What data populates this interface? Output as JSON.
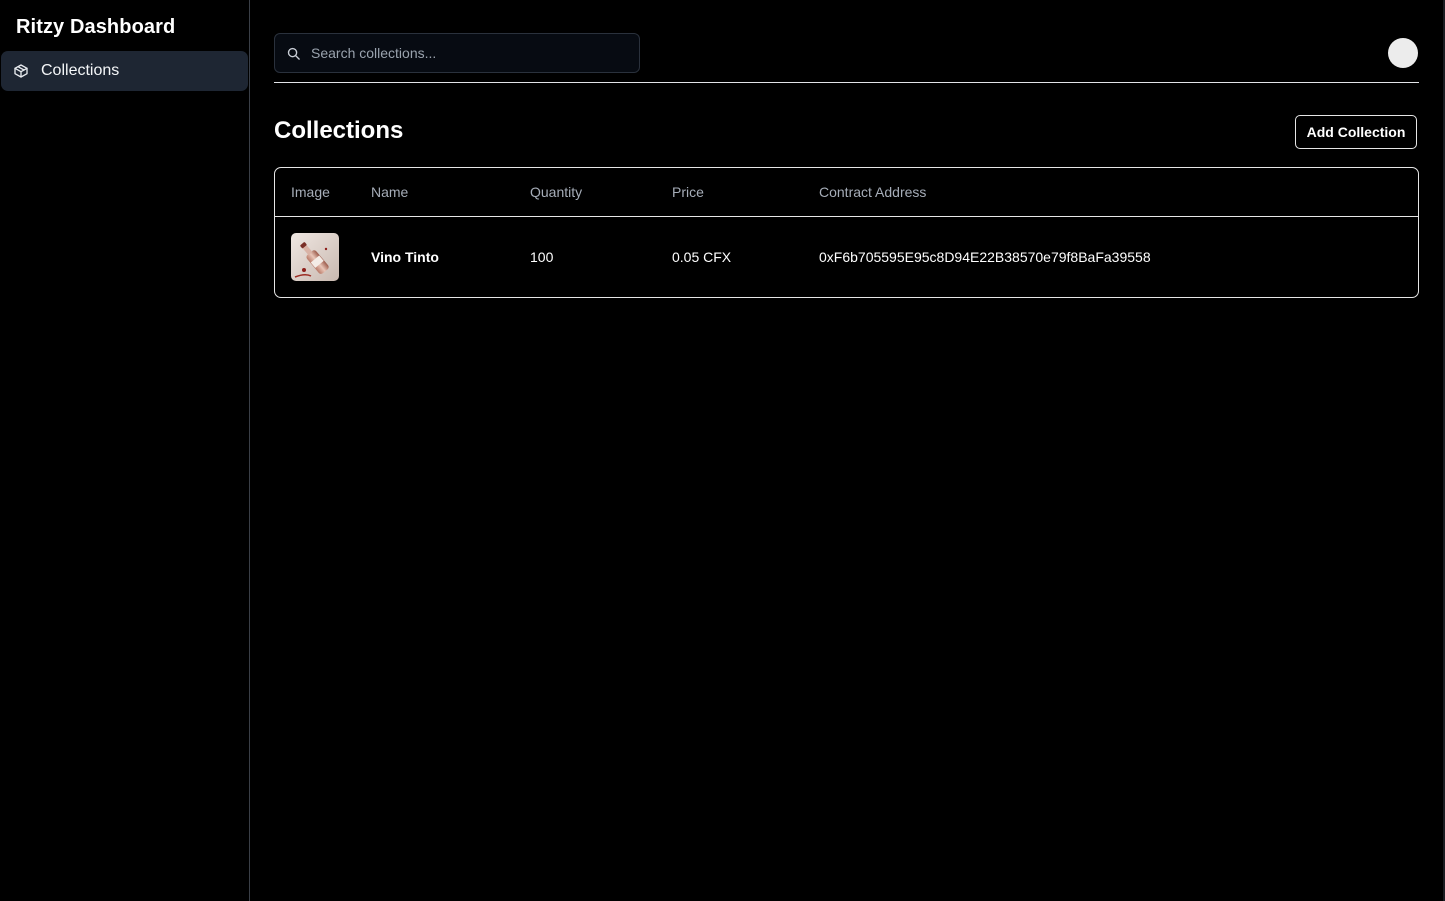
{
  "app": {
    "title": "Ritzy Dashboard"
  },
  "sidebar": {
    "items": [
      {
        "label": "Collections",
        "icon": "package-icon",
        "active": true
      }
    ]
  },
  "header": {
    "search": {
      "placeholder": "Search collections...",
      "value": ""
    }
  },
  "main": {
    "title": "Collections",
    "add_button_label": "Add Collection",
    "table": {
      "columns": [
        "Image",
        "Name",
        "Quantity",
        "Price",
        "Contract Address"
      ],
      "rows": [
        {
          "image_icon": "wine-bottle-thumbnail",
          "name": "Vino Tinto",
          "quantity": "100",
          "price": "0.05 CFX",
          "contract_address": "0xF6b705595E95c8D94E22B38570e79f8BaFa39558"
        }
      ]
    }
  },
  "colors": {
    "background": "#000000",
    "sidebar_active": "#1e2633",
    "border": "#e6e6e6",
    "muted_text": "#a6adb8"
  }
}
